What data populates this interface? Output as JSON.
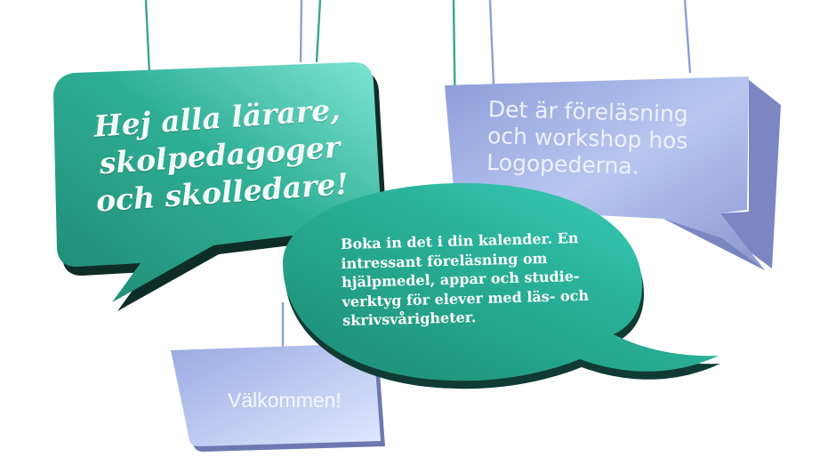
{
  "bubbles": {
    "greeting": "Hej alla lärare,\nskolpedagoger\noch skolledare!",
    "lecture_info": "Det är föreläsning\noch workshop hos\nLogopederna.",
    "invitation": "Boka in det i din kalender. En intressant föreläsning om hjälpmedel, appar och studie-verktyg för elever med läs- och skrivsvårigheter.",
    "welcome": "Välkommen!"
  },
  "colors": {
    "teal": "#2aa88f",
    "teal_dark": "#1f7e6b",
    "blue": "#a4b3e6",
    "blue_dark": "#7b86c2",
    "string": "#3ba58f"
  }
}
